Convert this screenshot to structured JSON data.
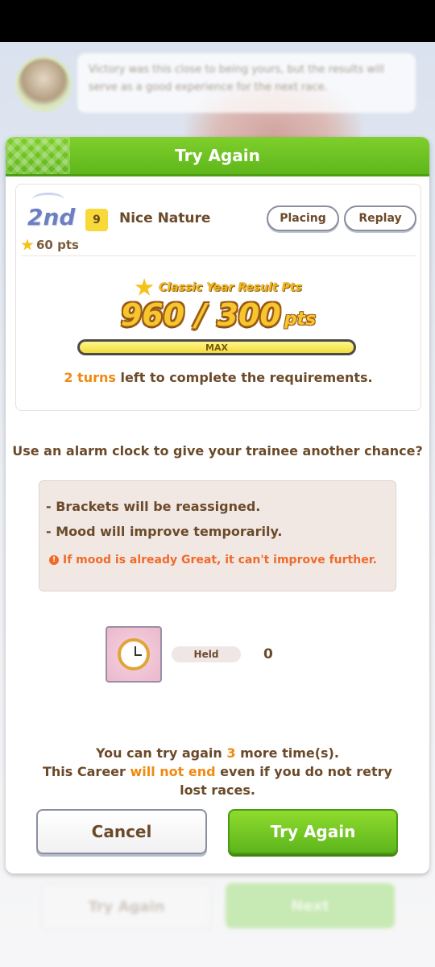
{
  "background": {
    "bubble_text": "Victory was this close to being yours, but the results will serve as a good experience for the next race.",
    "bottom_buttons": {
      "try_again": "Try Again",
      "next": "Next"
    }
  },
  "dialog": {
    "title": "Try Again",
    "result": {
      "placement": "2nd",
      "placement_points": "60 pts",
      "horse_number": "9",
      "horse_name": "Nice Nature",
      "placing_button": "Placing",
      "replay_button": "Replay",
      "points_label": "Classic Year Result Pts",
      "points_value": "960 / 300",
      "points_unit": "pts",
      "progress_percent": 100,
      "progress_label": "MAX",
      "turns_count": "2 turns",
      "turns_suffix": " left to complete the requirements."
    },
    "question": "Use an alarm clock to give your trainee another chance?",
    "info": {
      "line1": "- Brackets will be reassigned.",
      "line2": "- Mood will improve temporarily.",
      "warning": "If mood is already Great, it can't improve further."
    },
    "item": {
      "icon": "alarm-clock-icon",
      "held_label": "Held",
      "held_count": "0"
    },
    "retry": {
      "prefix": "You can try again ",
      "count": "3",
      "suffix": " more time(s).",
      "line2_prefix": "This Career ",
      "line2_accent": "will not end",
      "line2_suffix": " even if you do not retry lost races."
    },
    "buttons": {
      "cancel": "Cancel",
      "try_again": "Try Again"
    }
  },
  "colors": {
    "header_green": "#6cc224",
    "accent_orange": "#f08a10",
    "text_brown": "#6b4a2a",
    "warning_orange": "#f06a2a"
  }
}
